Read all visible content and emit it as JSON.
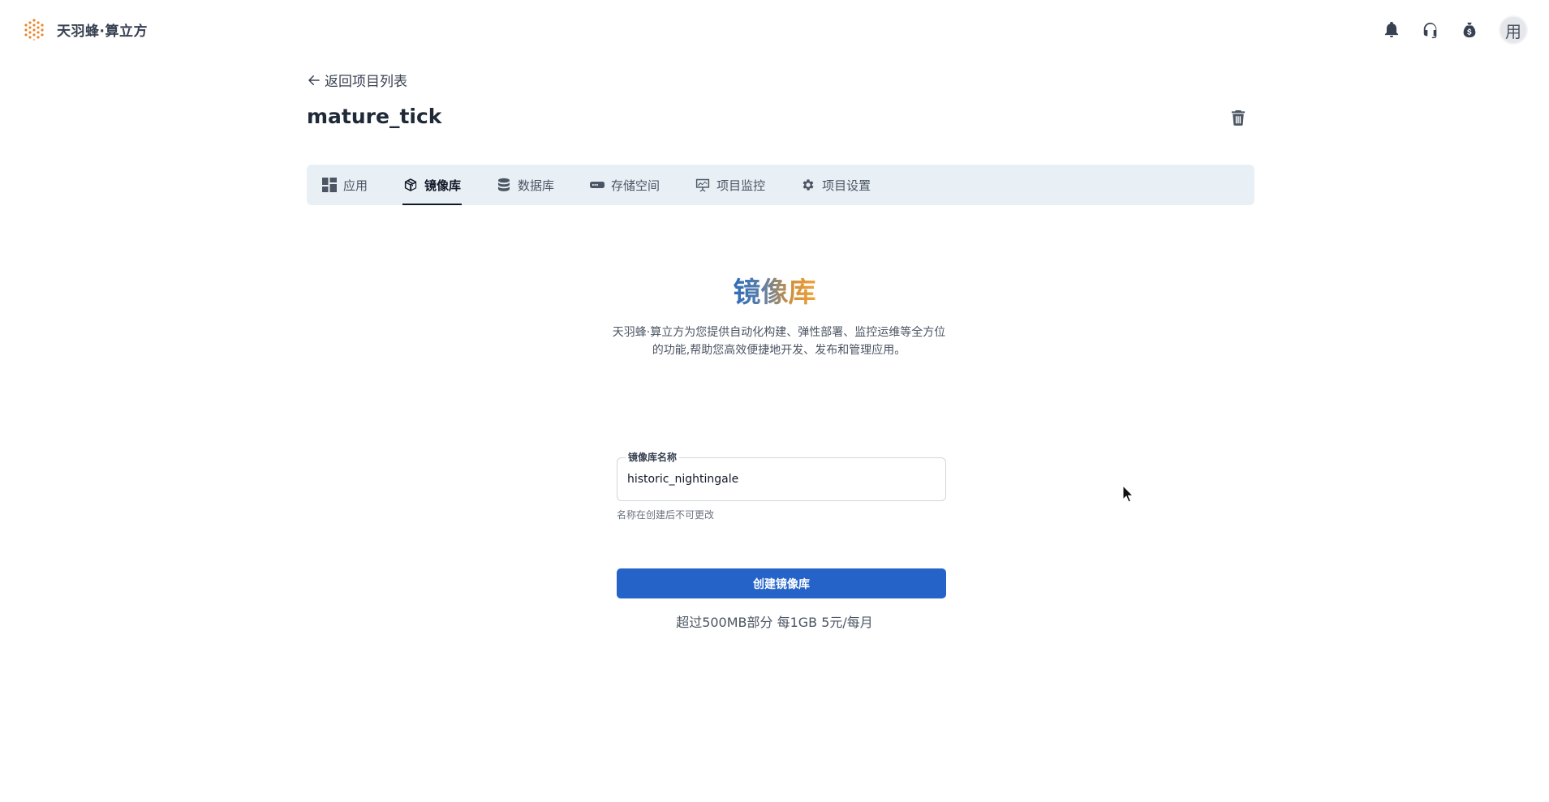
{
  "header": {
    "brand_name": "天羽蜂·算立方",
    "avatar_text": "用",
    "icons": [
      "bell-icon",
      "headset-icon",
      "money-bag-icon"
    ]
  },
  "project": {
    "back_label": "返回项目列表",
    "title": "mature_tick"
  },
  "tabs": [
    {
      "label": "应用",
      "icon": "grid-icon",
      "active": false
    },
    {
      "label": "镜像库",
      "icon": "package-icon",
      "active": true
    },
    {
      "label": "数据库",
      "icon": "database-icon",
      "active": false
    },
    {
      "label": "存储空间",
      "icon": "storage-icon",
      "active": false
    },
    {
      "label": "项目监控",
      "icon": "monitor-icon",
      "active": false
    },
    {
      "label": "项目设置",
      "icon": "gear-icon",
      "active": false
    }
  ],
  "hero": {
    "title": "镜像库",
    "description": "天羽蜂·算立方为您提供自动化构建、弹性部署、监控运维等全方位的功能,帮助您高效便捷地开发、发布和管理应用。"
  },
  "form": {
    "name_label": "镜像库名称",
    "name_value": "historic_nightingale",
    "name_hint": "名称在创建后不可更改",
    "submit_label": "创建镜像库",
    "price_note": "超过500MB部分  每1GB 5元/每月"
  },
  "colors": {
    "primary": "#2563c9",
    "tab_bg": "#e8f0f5",
    "brand_accent": "#e8882f"
  }
}
